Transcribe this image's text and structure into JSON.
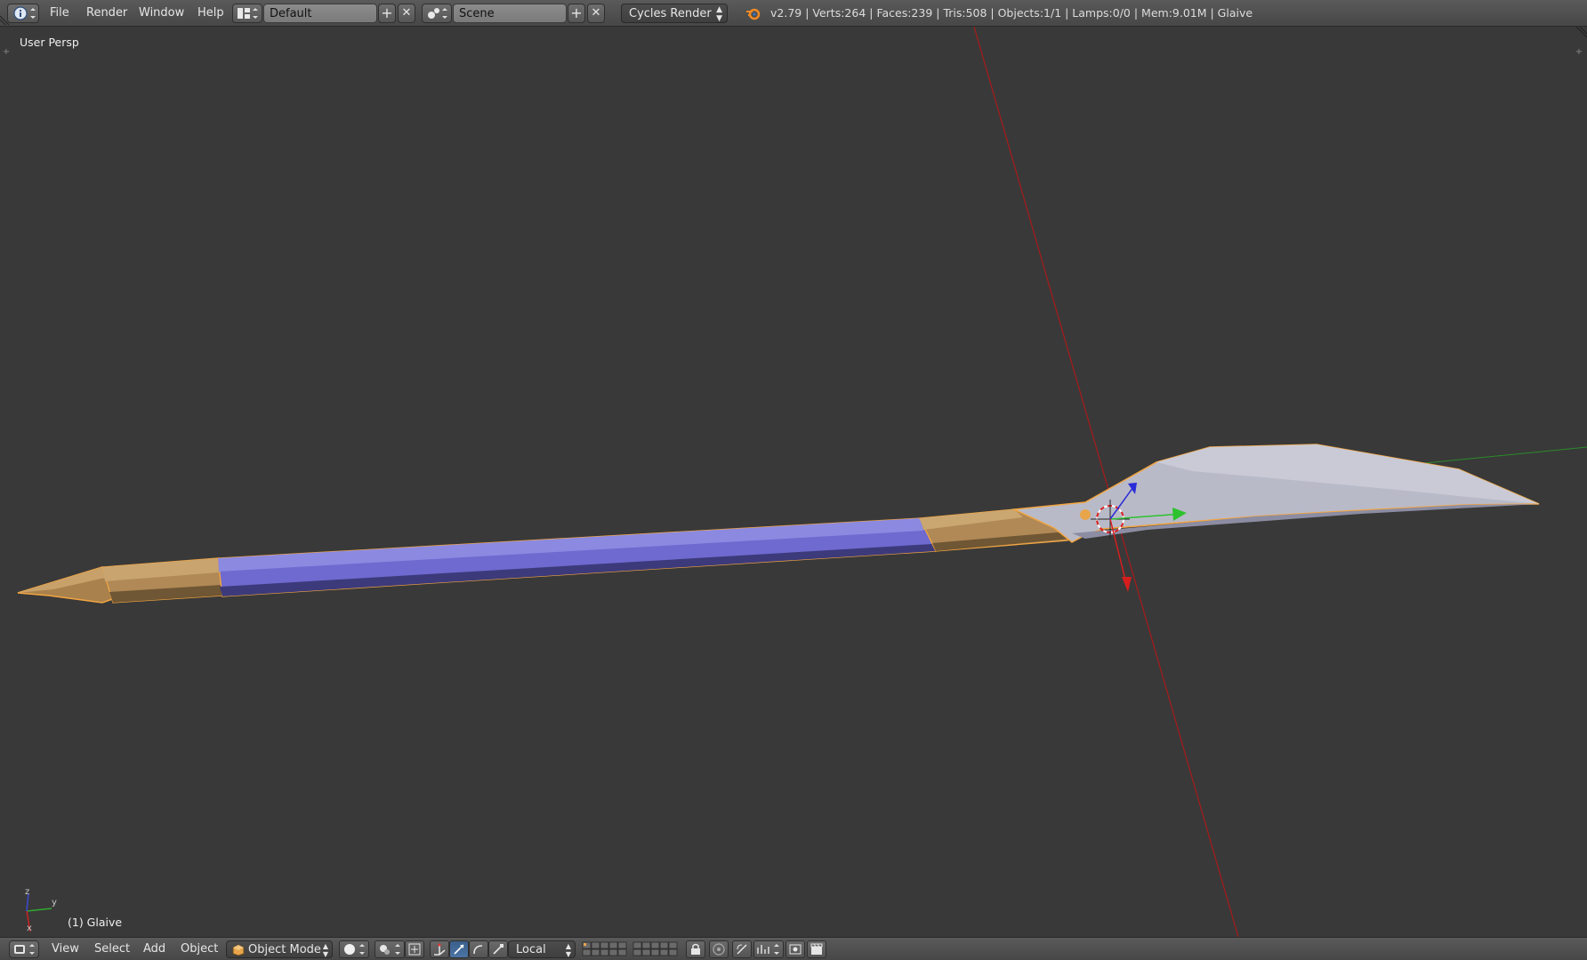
{
  "menu": {
    "file": "File",
    "render": "Render",
    "window": "Window",
    "help": "Help"
  },
  "screen_layout": {
    "value": "Default"
  },
  "scene": {
    "value": "Scene"
  },
  "render_engine": {
    "value": "Cycles Render"
  },
  "stats": "v2.79 | Verts:264 | Faces:239 | Tris:508 | Objects:1/1 | Lamps:0/0 | Mem:9.01M | Glaive",
  "viewport": {
    "view_label": "User Persp",
    "object_label": "(1) Glaive",
    "axis_x": "x",
    "axis_y": "y",
    "axis_z": "z"
  },
  "bottom": {
    "view": "View",
    "select": "Select",
    "add": "Add",
    "object": "Object",
    "mode": "Object Mode",
    "orientation": "Local"
  },
  "colors": {
    "viewport_bg": "#393939",
    "shaft_blue": "#6e6ad0",
    "bronze": "#b8955e",
    "blade": "#b9bac8",
    "selection_outline": "#f2a541",
    "axis_red": "#b01e1e",
    "axis_green": "#2fa82f"
  },
  "icons": [
    "info-icon",
    "layout-icon",
    "scene-icon",
    "blender-logo-icon",
    "view3d-editor-icon",
    "object-mode-icon",
    "shading-icon",
    "pivot-icon",
    "manipulator-icon",
    "translate-icon",
    "rotate-icon",
    "scale-icon",
    "layers-icon",
    "lock-icon",
    "proportional-icon",
    "snap-icon",
    "render-icon",
    "camera-icon"
  ]
}
